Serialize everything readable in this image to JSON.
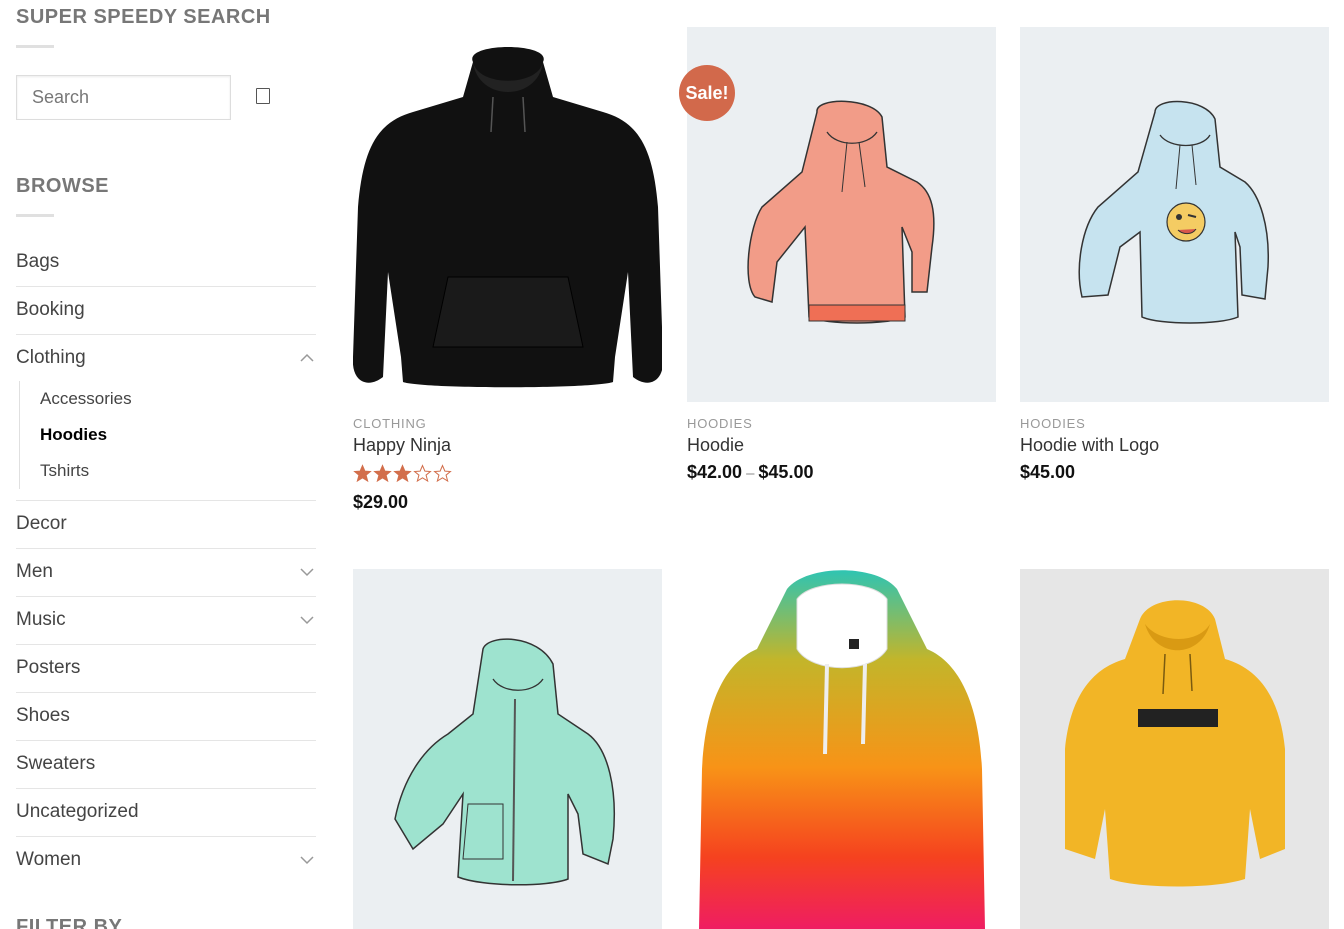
{
  "sidebar": {
    "search_title": "SUPER SPEEDY SEARCH",
    "search": {
      "placeholder": "Search",
      "value": ""
    },
    "browse_title": "BROWSE",
    "categories": [
      {
        "label": "Bags",
        "has_toggle": false
      },
      {
        "label": "Booking",
        "has_toggle": false
      },
      {
        "label": "Clothing",
        "has_toggle": true,
        "expanded": true,
        "children": [
          {
            "label": "Accessories",
            "active": false
          },
          {
            "label": "Hoodies",
            "active": true
          },
          {
            "label": "Tshirts",
            "active": false
          }
        ]
      },
      {
        "label": "Decor",
        "has_toggle": false
      },
      {
        "label": "Men",
        "has_toggle": true
      },
      {
        "label": "Music",
        "has_toggle": true
      },
      {
        "label": "Posters",
        "has_toggle": false
      },
      {
        "label": "Shoes",
        "has_toggle": false
      },
      {
        "label": "Sweaters",
        "has_toggle": false
      },
      {
        "label": "Uncategorized",
        "has_toggle": false
      },
      {
        "label": "Women",
        "has_toggle": true
      }
    ],
    "filter_title": "FILTER BY"
  },
  "products": [
    {
      "category": "CLOTHING",
      "name": "Happy Ninja",
      "price": "$29.00",
      "rating": 3,
      "rating_max": 5,
      "image_icon": "black-hoodie-image"
    },
    {
      "category": "HOODIES",
      "name": "Hoodie",
      "price_min": "$42.00",
      "price_sep": "–",
      "price_max": "$45.00",
      "sale": "Sale!",
      "image_icon": "pink-hoodie-image"
    },
    {
      "category": "HOODIES",
      "name": "Hoodie with Logo",
      "price": "$45.00",
      "image_icon": "blue-hoodie-logo-image"
    },
    {
      "image_icon": "mint-zip-hoodie-image"
    },
    {
      "image_icon": "gradient-hoodie-image"
    },
    {
      "image_icon": "yellow-hoodie-image"
    }
  ],
  "colors": {
    "accent": "#d2694b",
    "star": "#d26e4b",
    "text": "#333333",
    "muted": "#777777"
  }
}
